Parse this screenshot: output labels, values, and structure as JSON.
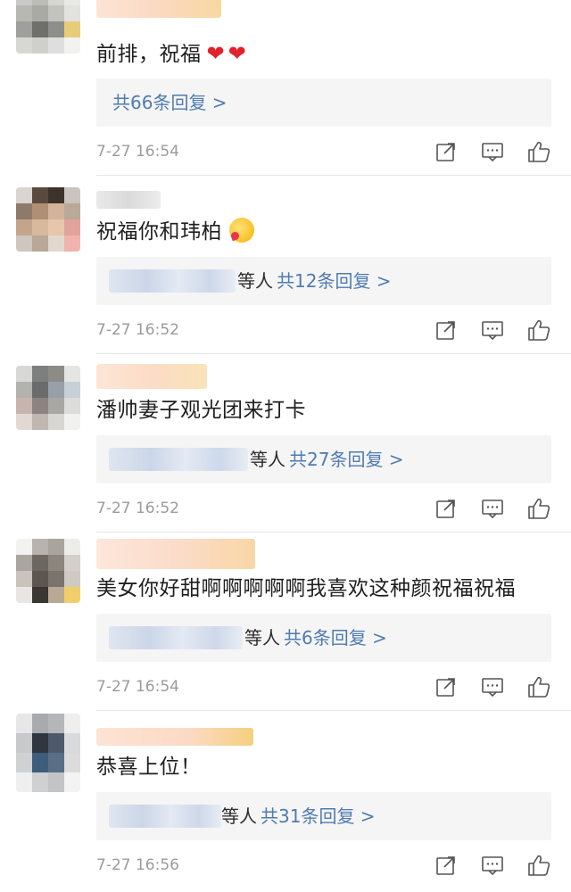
{
  "comments": [
    {
      "text": "前排，祝福",
      "emoji": "heart-heart",
      "reply_who": "",
      "reply_count": "共66条回复 >",
      "time": "7-27 16:54"
    },
    {
      "text": "祝福你和玮柏",
      "emoji": "kissing-face-icon",
      "reply_who": "等人",
      "reply_count": "共12条回复 >",
      "time": "7-27 16:52"
    },
    {
      "text": "潘帅妻子观光团来打卡",
      "emoji": "",
      "reply_who": "等人",
      "reply_count": "共27条回复 >",
      "time": "7-27 16:52"
    },
    {
      "text": "美女你好甜啊啊啊啊啊我喜欢这种颜祝福祝福",
      "emoji": "",
      "reply_who": "等人",
      "reply_count": "共6条回复 >",
      "time": "7-27 16:54"
    },
    {
      "text": "恭喜上位！",
      "emoji": "",
      "reply_who": "等人",
      "reply_count": "共31条回复 >",
      "time": "7-27 16:56"
    }
  ],
  "icons": {
    "share": "share-icon",
    "comment": "comment-icon",
    "like": "thumbs-up-icon"
  },
  "colors": {
    "link": "#4f7bb0",
    "time": "#9b9b9b",
    "reply_bg": "#f5f5f5",
    "heart": "#e0222d"
  }
}
